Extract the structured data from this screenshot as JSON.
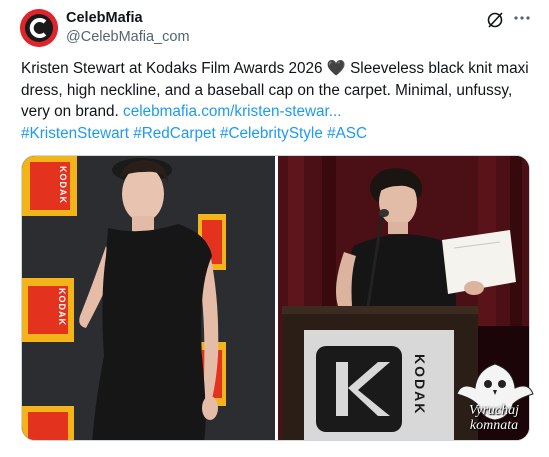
{
  "post": {
    "author_name": "CelebMafia",
    "author_handle": "@CelebMafia_com",
    "grok_icon": "grok-icon",
    "more_icon": "more-dots-icon",
    "text_lines": [
      "Kristen Stewart at Kodaks Film Awards 2026",
      "Sleeveless black knit maxi dress, high neckline, and a baseball cap on the carpet. Minimal, unfussy, very on brand."
    ],
    "heart_emoji": "🖤",
    "link": "celebmafia.com/kristen-stewar...",
    "hashtags": "#KristenStewart #RedCarpet #CelebrityStyle #ASC"
  },
  "media": {
    "left_photo": "kristen-stewart-red-carpet-photo",
    "right_photo": "kristen-stewart-podium-photo",
    "kodak_logo_text": "KODAK",
    "podium_logo_text": "KODAK"
  },
  "watermark": {
    "line1": "Vyruchaj",
    "line2": "komnata"
  },
  "colors": {
    "link": "#1d9bf0",
    "avatar_red": "#e0242b",
    "kodak_yellow": "#f3b419",
    "kodak_red": "#e3331e"
  }
}
